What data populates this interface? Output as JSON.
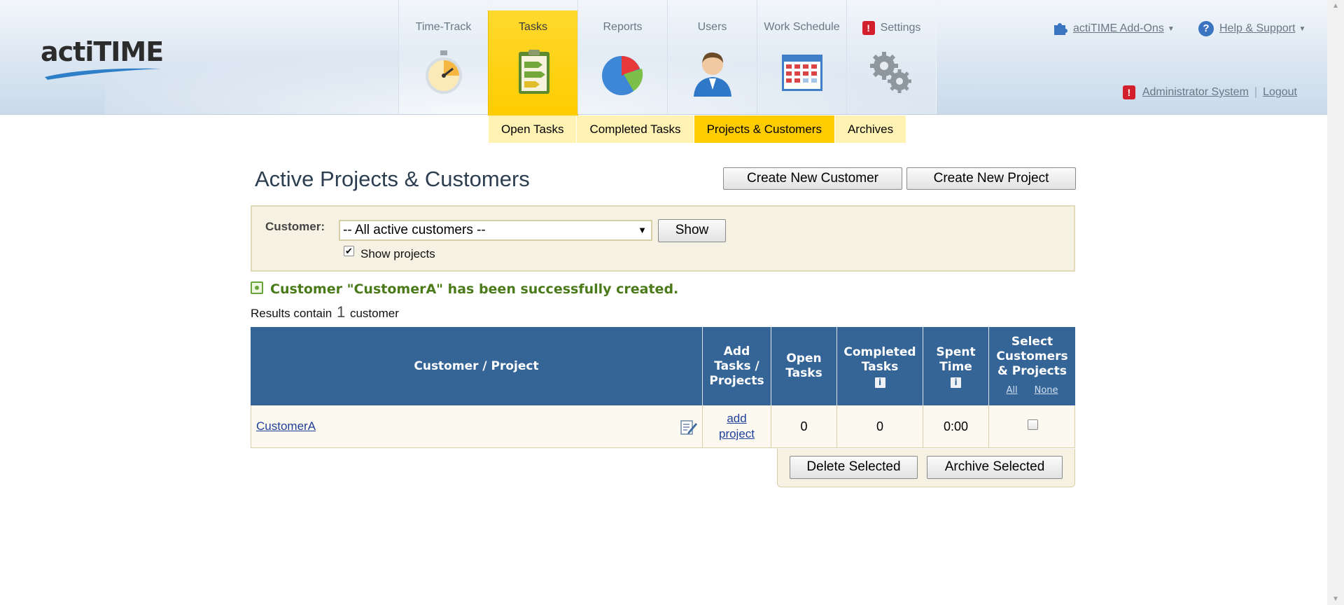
{
  "app": {
    "logo_text": "actiTIME"
  },
  "nav": {
    "items": [
      {
        "label": "Time-Track",
        "icon": "stopwatch-icon"
      },
      {
        "label": "Tasks",
        "icon": "clipboard-icon",
        "active": true
      },
      {
        "label": "Reports",
        "icon": "pie-chart-icon"
      },
      {
        "label": "Users",
        "icon": "user-icon"
      },
      {
        "label": "Work Schedule",
        "icon": "calendar-icon"
      },
      {
        "label": "Settings",
        "icon": "gears-icon",
        "alert": "!"
      }
    ]
  },
  "topbar": {
    "addons_label": "actiTIME Add-Ons",
    "help_label": "Help & Support",
    "help_icon_glyph": "?",
    "user_alert": "!",
    "user_name": "Administrator System",
    "logout_label": "Logout"
  },
  "subnav": {
    "items": [
      {
        "label": "Open Tasks"
      },
      {
        "label": "Completed Tasks"
      },
      {
        "label": "Projects & Customers",
        "active": true
      },
      {
        "label": "Archives"
      }
    ]
  },
  "page": {
    "title": "Active Projects & Customers",
    "create_customer_label": "Create New Customer",
    "create_project_label": "Create New Project"
  },
  "filter": {
    "customer_label": "Customer:",
    "customer_value": "-- All active customers --",
    "select_arrow": "▼",
    "show_label": "Show",
    "show_projects_label": "Show projects",
    "show_projects_checked": "✔"
  },
  "message": {
    "success": "Customer \"CustomerA\" has been successfully created."
  },
  "results": {
    "prefix": "Results contain",
    "count": "1",
    "suffix": "customer"
  },
  "table": {
    "headers": {
      "customer_project": "Customer / Project",
      "add_line1": "Add",
      "add_line2": "Tasks /",
      "add_line3": "Projects",
      "open_line1": "Open",
      "open_line2": "Tasks",
      "completed_line1": "Completed",
      "completed_line2": "Tasks",
      "spent_line1": "Spent",
      "spent_line2": "Time",
      "select_line1": "Select",
      "select_line2": "Customers",
      "select_line3": "& Projects",
      "select_all": "All",
      "select_none": "None",
      "info_glyph": "i"
    },
    "rows": [
      {
        "name": "CustomerA",
        "add_line1": "add",
        "add_line2": "project",
        "open_tasks": "0",
        "completed_tasks": "0",
        "spent_time": "0:00"
      }
    ],
    "delete_label": "Delete Selected",
    "archive_label": "Archive Selected"
  },
  "scrollbar": {
    "up": "▲",
    "down": "▼"
  },
  "colors": {
    "accent_yellow": "#ffcc00",
    "table_header_blue": "#356496",
    "success_green": "#4a7a1a",
    "link_blue": "#1f3f9a"
  }
}
